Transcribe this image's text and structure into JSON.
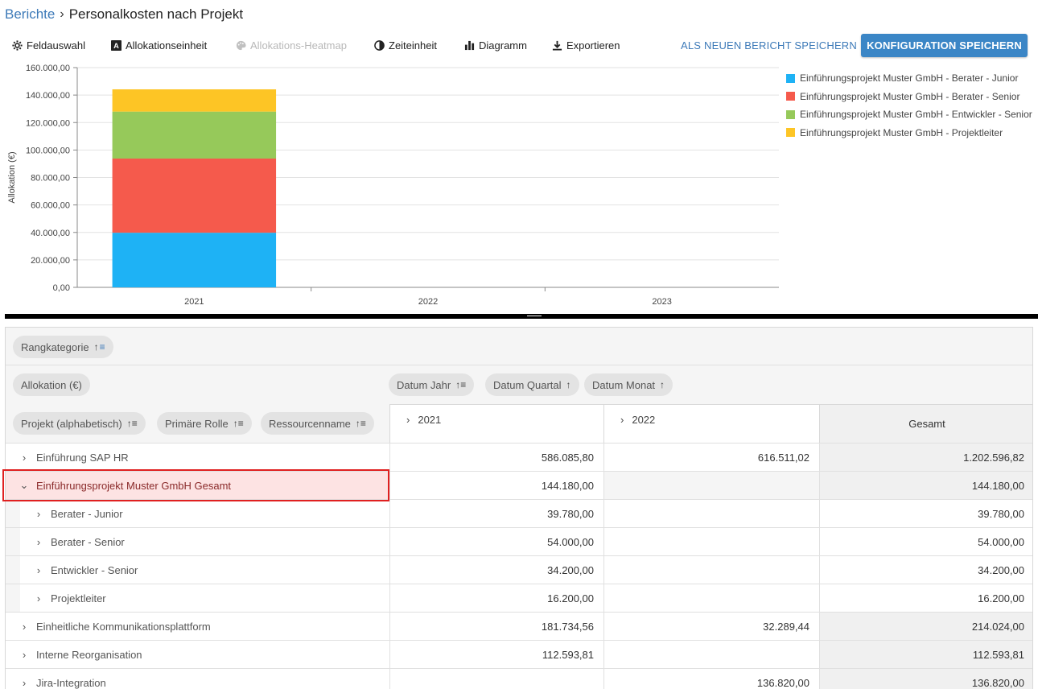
{
  "breadcrumb": {
    "parent": "Berichte",
    "separator": "›",
    "title": "Personalkosten nach Projekt"
  },
  "toolbar": {
    "field_select": "Feldauswahl",
    "alloc_unit": "Allokationseinheit",
    "heatmap": "Allokations-Heatmap",
    "time_unit": "Zeiteinheit",
    "diagram": "Diagramm",
    "export": "Exportieren",
    "save_new": "ALS NEUEN BERICHT SPEICHERN",
    "save_config": "KONFIGURATION SPEICHERN"
  },
  "colors": {
    "accent": "#3b86c6",
    "junior": "#1eb2f5",
    "senior": "#f55a4c",
    "dev": "#96c95a",
    "lead": "#fdc525"
  },
  "chart_data": {
    "type": "bar",
    "stacked": true,
    "categories": [
      "2021",
      "2022",
      "2023"
    ],
    "ylabel": "Allokation (€)",
    "ylim": [
      0,
      160000
    ],
    "yticks": [
      "0,00",
      "20.000,00",
      "40.000,00",
      "60.000,00",
      "80.000,00",
      "100.000,00",
      "120.000,00",
      "140.000,00",
      "160.000,00"
    ],
    "grid": true,
    "legend_position": "right",
    "series": [
      {
        "name": "Einführungsprojekt Muster GmbH - Berater - Junior",
        "color": "#1eb2f5",
        "values": [
          39780,
          0,
          0
        ]
      },
      {
        "name": "Einführungsprojekt Muster GmbH - Berater - Senior",
        "color": "#f55a4c",
        "values": [
          54000,
          0,
          0
        ]
      },
      {
        "name": "Einführungsprojekt Muster GmbH - Entwickler - Senior",
        "color": "#96c95a",
        "values": [
          34200,
          0,
          0
        ]
      },
      {
        "name": "Einführungsprojekt Muster GmbH - Projektleiter",
        "color": "#fdc525",
        "values": [
          16200,
          0,
          0
        ]
      }
    ]
  },
  "pivot": {
    "filter_chip": "Rangkategorie",
    "value_chip": "Allokation (€)",
    "col_chips": [
      "Datum Jahr",
      "Datum Quartal",
      "Datum Monat"
    ],
    "row_chips": [
      "Projekt (alphabetisch)",
      "Primäre Rolle",
      "Ressourcenname"
    ],
    "columns": [
      "2021",
      "2022"
    ],
    "total_label": "Gesamt",
    "rows": [
      {
        "name": "Einführung SAP HR",
        "v2021": "586.085,80",
        "v2022": "616.511,02",
        "total": "1.202.596,82",
        "expanded": false
      },
      {
        "name": "Einführungsprojekt Muster GmbH Gesamt",
        "v2021": "144.180,00",
        "v2022": "",
        "total": "144.180,00",
        "expanded": true
      },
      {
        "name": "Berater - Junior",
        "v2021": "39.780,00",
        "v2022": "",
        "total": "39.780,00",
        "sub": true
      },
      {
        "name": "Berater - Senior",
        "v2021": "54.000,00",
        "v2022": "",
        "total": "54.000,00",
        "sub": true
      },
      {
        "name": "Entwickler - Senior",
        "v2021": "34.200,00",
        "v2022": "",
        "total": "34.200,00",
        "sub": true
      },
      {
        "name": "Projektleiter",
        "v2021": "16.200,00",
        "v2022": "",
        "total": "16.200,00",
        "sub": true
      },
      {
        "name": "Einheitliche Kommunikationsplattform",
        "v2021": "181.734,56",
        "v2022": "32.289,44",
        "total": "214.024,00",
        "expanded": false
      },
      {
        "name": "Interne Reorganisation",
        "v2021": "112.593,81",
        "v2022": "",
        "total": "112.593,81",
        "expanded": false
      },
      {
        "name": "Jira-Integration",
        "v2021": "",
        "v2022": "136.820,00",
        "total": "136.820,00",
        "expanded": false
      }
    ]
  }
}
